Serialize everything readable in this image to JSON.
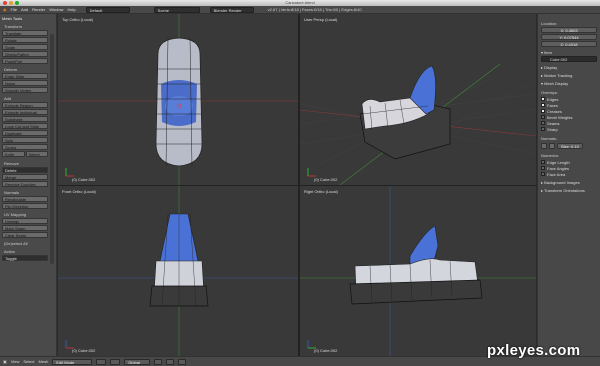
{
  "window_title": "Caricature.blend",
  "top_menu": {
    "items": [
      "File",
      "Add",
      "Render",
      "Window",
      "Help"
    ],
    "layout": "Default",
    "scene": "Scene",
    "engine": "Blender Render",
    "stats": "v2.67 | Verts:8/18 | Faces:0/18 | Tris:0/0 | Edges:8/40"
  },
  "toolshelf": {
    "title": "Mesh Tools",
    "transform_header": "Transform",
    "transform": [
      "Translate",
      "Rotate",
      "Scale",
      "Shrink/Fatten",
      "Push/Pull"
    ],
    "deform_header": "Deform",
    "deform": [
      "Edge Slide",
      "Noise",
      "Smooth Vertex"
    ],
    "add_header": "Add",
    "add": [
      "Extrude Region",
      "Extrude Individual",
      "Subdivide",
      "Loop Cut and Slide",
      "Duplicate",
      "Spin",
      "Screw"
    ],
    "knife": "Knife",
    "select": "Select",
    "remove_header": "Remove",
    "delete": "Delete",
    "merge": "Merge",
    "remove_doubles": "Remove Doubles",
    "normals_header": "Normals",
    "recalculate": "Recalculate",
    "flip_direction": "Flip Direction",
    "uv_header": "UV Mapping",
    "uv": [
      "Unwrap",
      "Mark Seam",
      "Clear Seam"
    ],
    "deselect_all": "(De)select All",
    "action_header": "Action",
    "action_value": "Toggle"
  },
  "viewports": [
    {
      "label": "Top Ortho (Local)",
      "object": "(0) Cube.002"
    },
    {
      "label": "User Persp (Local)",
      "object": "(0) Cube.002"
    },
    {
      "label": "Front Ortho (Local)",
      "object": "(0) Cube.002"
    },
    {
      "label": "Right Ortho (Local)",
      "object": "(0) Cube.002"
    }
  ],
  "properties": {
    "location_header": "Location:",
    "x": "X: 0.4603",
    "y": "Y: 0.07544",
    "z": "Z: 0.4318",
    "item_header": "Item",
    "object_name": "Cube.002",
    "display": "Display",
    "motion_tracking": "Motion Tracking",
    "mesh_display": "Mesh Display",
    "overlays_header": "Overlays:",
    "overlays": [
      {
        "label": "Edges",
        "checked": true
      },
      {
        "label": "Faces",
        "checked": true
      },
      {
        "label": "Creases",
        "checked": true
      },
      {
        "label": "Bevel Weights",
        "checked": false
      },
      {
        "label": "Seams",
        "checked": false
      },
      {
        "label": "Sharp",
        "checked": false
      }
    ],
    "normals_header": "Normals:",
    "normals_size": "Size: 0.10",
    "numerics_header": "Numerics:",
    "numerics": [
      "Edge Length",
      "Face Angles",
      "Face Area"
    ],
    "background_images": "Background Images",
    "transform_orientations": "Transform Orientations"
  },
  "bottom_bar": {
    "items": [
      "View",
      "Select",
      "Mesh"
    ],
    "mode": "Edit Mode",
    "pivot": "Global"
  },
  "watermark": "pxleyes.com"
}
